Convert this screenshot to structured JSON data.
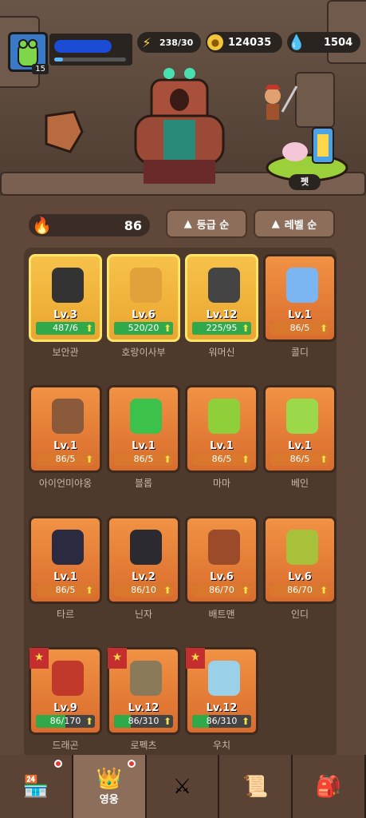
{
  "player": {
    "level": "15"
  },
  "resources": {
    "energy": "238/30",
    "gold": "124035",
    "gems": "1504"
  },
  "pet_button": "펫",
  "power": "86",
  "sort": {
    "grade": "등급 순",
    "level": "레벨 순"
  },
  "heroes": [
    {
      "name": "보안관",
      "lv": "Lv.3",
      "prog": "487/6",
      "frac": 1,
      "style": "gold",
      "star": false,
      "color": "#333"
    },
    {
      "name": "호랑이사부",
      "lv": "Lv.6",
      "prog": "520/20",
      "frac": 1,
      "style": "gold",
      "star": false,
      "color": "#e2a23b"
    },
    {
      "name": "워머신",
      "lv": "Lv.12",
      "prog": "225/95",
      "frac": 1,
      "style": "gold",
      "star": false,
      "color": "#444"
    },
    {
      "name": "콜디",
      "lv": "Lv.1",
      "prog": "86/5",
      "frac": 1,
      "style": "orange",
      "star": false,
      "color": "#7bb6f2"
    },
    {
      "name": "아이언미야옹",
      "lv": "Lv.1",
      "prog": "86/5",
      "frac": 1,
      "style": "orange",
      "star": false,
      "color": "#8a5a3a"
    },
    {
      "name": "블롭",
      "lv": "Lv.1",
      "prog": "86/5",
      "frac": 1,
      "style": "orange",
      "star": false,
      "color": "#3cc14b"
    },
    {
      "name": "마마",
      "lv": "Lv.1",
      "prog": "86/5",
      "frac": 1,
      "style": "orange",
      "star": false,
      "color": "#8fd03a"
    },
    {
      "name": "베인",
      "lv": "Lv.1",
      "prog": "86/5",
      "frac": 1,
      "style": "orange",
      "star": false,
      "color": "#9bd84a"
    },
    {
      "name": "타르",
      "lv": "Lv.1",
      "prog": "86/5",
      "frac": 1,
      "style": "orange",
      "star": false,
      "color": "#2a2a40"
    },
    {
      "name": "닌자",
      "lv": "Lv.2",
      "prog": "86/10",
      "frac": 1,
      "style": "orange",
      "star": false,
      "color": "#2a2a30"
    },
    {
      "name": "배트맨",
      "lv": "Lv.6",
      "prog": "86/70",
      "frac": 1,
      "style": "orange",
      "star": false,
      "color": "#9b4a2a"
    },
    {
      "name": "인디",
      "lv": "Lv.6",
      "prog": "86/70",
      "frac": 1,
      "style": "orange",
      "star": false,
      "color": "#a7c23a"
    },
    {
      "name": "드래곤",
      "lv": "Lv.9",
      "prog": "86/170",
      "frac": 0.5,
      "style": "orange",
      "star": true,
      "color": "#c0392b"
    },
    {
      "name": "로펙츠",
      "lv": "Lv.12",
      "prog": "86/310",
      "frac": 0.28,
      "style": "orange",
      "star": true,
      "color": "#8a7a5a"
    },
    {
      "name": "우치",
      "lv": "Lv.12",
      "prog": "86/310",
      "frac": 0.28,
      "style": "orange",
      "star": true,
      "color": "#9ad0e8"
    }
  ],
  "tabs": [
    {
      "icon": "shop-icon",
      "label": "",
      "active": false,
      "dot": true
    },
    {
      "icon": "crown-icon",
      "label": "영웅",
      "active": true,
      "dot": true
    },
    {
      "icon": "swords-icon",
      "label": "",
      "active": false,
      "dot": false
    },
    {
      "icon": "scroll-icon",
      "label": "",
      "active": false,
      "dot": false
    },
    {
      "icon": "items-icon",
      "label": "",
      "active": false,
      "dot": false
    }
  ]
}
